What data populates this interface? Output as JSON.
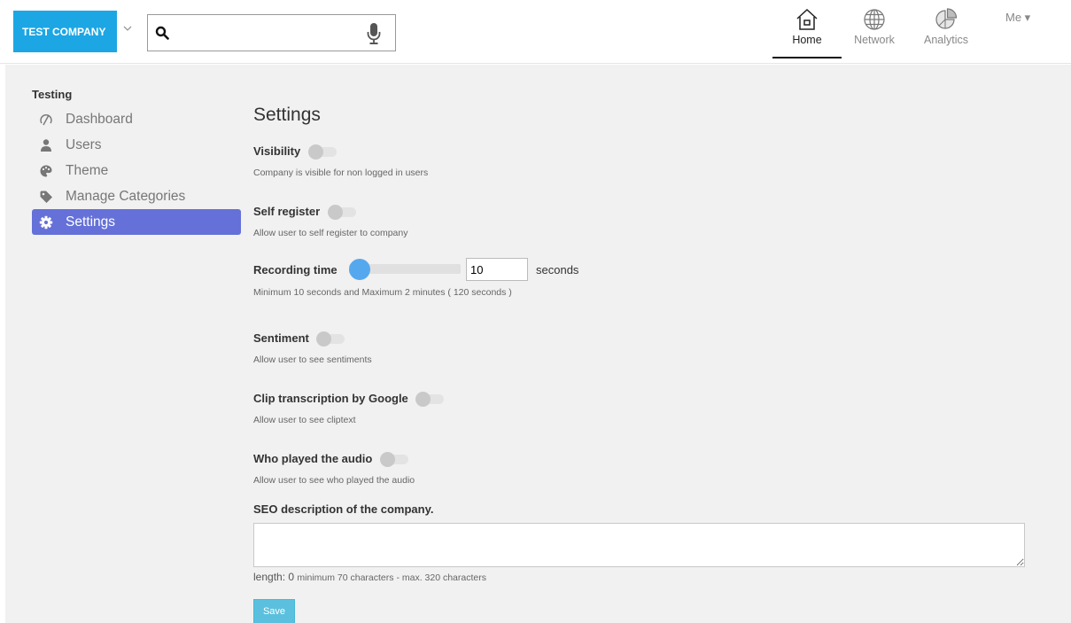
{
  "header": {
    "company": "TEST COMPANY",
    "search": {
      "value": "",
      "placeholder": ""
    },
    "nav": [
      {
        "label": "Home",
        "icon": "home-icon",
        "active": true
      },
      {
        "label": "Network",
        "icon": "globe-icon",
        "active": false
      },
      {
        "label": "Analytics",
        "icon": "pie-chart-icon",
        "active": false
      }
    ],
    "me": "Me ▾"
  },
  "sidebar": {
    "title": "Testing",
    "items": [
      {
        "label": "Dashboard",
        "icon": "dashboard-icon"
      },
      {
        "label": "Users",
        "icon": "user-icon"
      },
      {
        "label": "Theme",
        "icon": "palette-icon"
      },
      {
        "label": "Manage Categories",
        "icon": "tag-icon"
      },
      {
        "label": "Settings",
        "icon": "gear-icon",
        "active": true
      }
    ]
  },
  "main": {
    "title": "Settings",
    "visibility": {
      "label": "Visibility",
      "desc": "Company is visible for non logged in users",
      "on": false
    },
    "self_register": {
      "label": "Self register",
      "desc": "Allow user to self register to company",
      "on": false
    },
    "recording": {
      "label": "Recording time",
      "value": "10",
      "unit": "seconds",
      "desc": "Minimum 10 seconds and Maximum 2 minutes ( 120 seconds )",
      "min": 10,
      "max": 120
    },
    "sentiment": {
      "label": "Sentiment",
      "desc": "Allow user to see sentiments",
      "on": false
    },
    "clip": {
      "label": "Clip transcription by Google",
      "desc": "Allow user to see cliptext",
      "on": false
    },
    "who_played": {
      "label": "Who played the audio",
      "desc": "Allow user to see who played the audio",
      "on": false
    },
    "seo": {
      "label": "SEO description of the company.",
      "value": "",
      "length_label": "length:",
      "length_value": "0",
      "hint": "minimum 70 characters - max. 320 characters"
    },
    "save_label": "Save"
  },
  "colors": {
    "brand": "#1ca6e4",
    "active_nav": "#6571d8",
    "slider_knob": "#56a8ee",
    "save_button": "#5bc0de"
  }
}
